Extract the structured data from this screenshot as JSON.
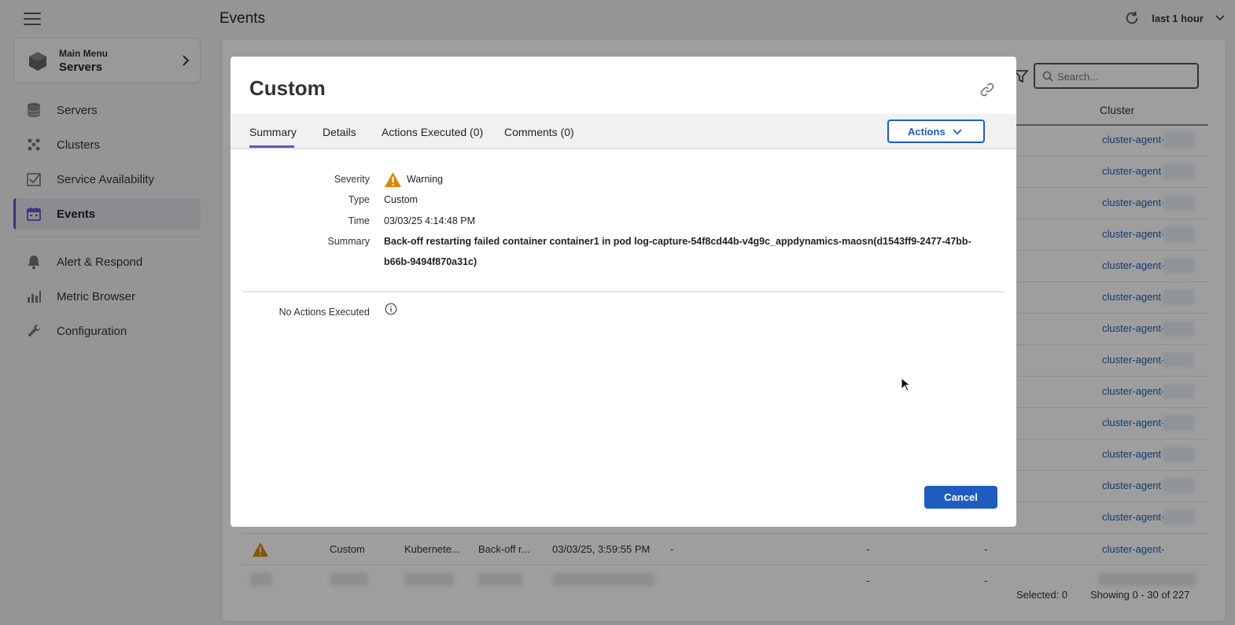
{
  "header": {
    "page_title": "Events",
    "time_range": "last 1 hour"
  },
  "sidebar": {
    "main_menu_label": "Main Menu",
    "main_menu_value": "Servers",
    "items": [
      {
        "label": "Servers",
        "icon": "database-icon"
      },
      {
        "label": "Clusters",
        "icon": "clusters-icon"
      },
      {
        "label": "Service Availability",
        "icon": "checkbox-icon"
      },
      {
        "label": "Events",
        "icon": "calendar-icon"
      },
      {
        "label": "Alert & Respond",
        "icon": "bell-icon"
      },
      {
        "label": "Metric Browser",
        "icon": "bar-chart-icon"
      },
      {
        "label": "Configuration",
        "icon": "wrench-icon"
      }
    ]
  },
  "table": {
    "search_placeholder": "Search...",
    "cluster_header": "Cluster",
    "cluster_link": "cluster-agent-",
    "cluster_link_short": "cluster-agent",
    "visible_row": {
      "type": "Custom",
      "source": "Kubernete...",
      "summary": "Back-off r...",
      "time": "03/03/25, 3:59:55 PM",
      "dash": "-"
    },
    "dash": "-",
    "selected": "Selected: 0",
    "showing": "Showing 0 - 30 of 227"
  },
  "modal": {
    "title": "Custom",
    "tabs": [
      "Summary",
      "Details",
      "Actions Executed (0)",
      "Comments (0)"
    ],
    "actions_label": "Actions",
    "fields": {
      "severity_label": "Severity",
      "severity_value": "Warning",
      "type_label": "Type",
      "type_value": "Custom",
      "time_label": "Time",
      "time_value": "03/03/25 4:14:48 PM",
      "summary_label": "Summary",
      "summary_value": "Back-off restarting failed container container1 in pod log-capture-54f8cd44b-v4g9c_appdynamics-maosn(d1543ff9-2477-47bb-b66b-9494f870a31c)"
    },
    "no_actions_label": "No Actions Executed",
    "cancel_label": "Cancel"
  },
  "colors": {
    "accent": "#6b4ec9",
    "primary_button": "#1e5cc0",
    "link": "#1b5fb8",
    "warning": "#e08a00"
  }
}
